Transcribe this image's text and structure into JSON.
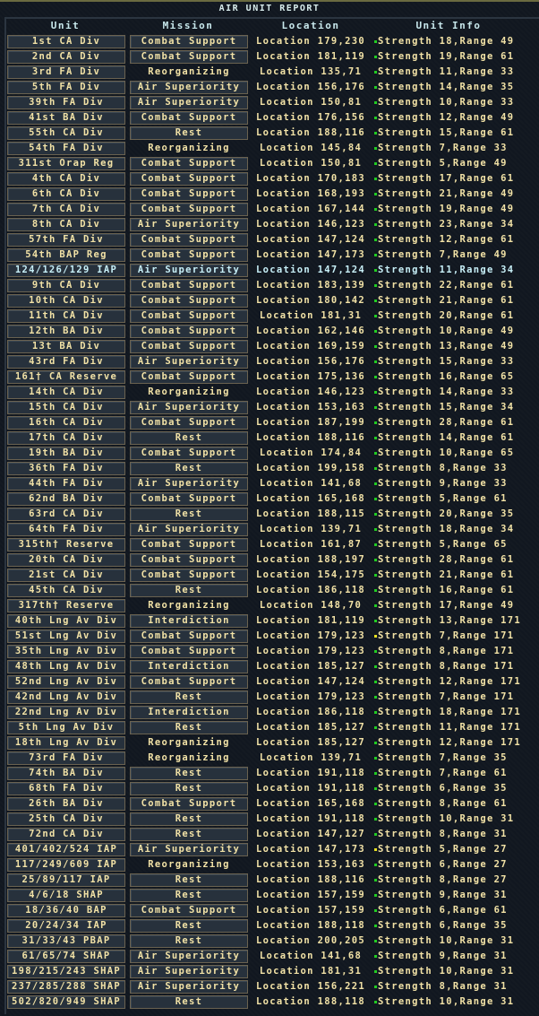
{
  "title": "AIR UNIT REPORT",
  "columns": {
    "unit": "Unit",
    "mission": "Mission",
    "location": "Location",
    "info": "Unit Info"
  },
  "colors": {
    "text": "#f2e2a6",
    "selected_text": "#c8f0f8",
    "dot_green": "#22cc22",
    "dot_yellow": "#e8e020"
  },
  "rows": [
    [
      "1st CA Div",
      "Combat Support",
      "Location 179,230",
      "Strength 18,Range 49"
    ],
    [
      "2nd CA Div",
      "Combat Support",
      "Location 181,119",
      "Strength 19,Range 61"
    ],
    [
      "3rd FA Div",
      "Reorganizing",
      "Location 135,71",
      "Strength 11,Range 33"
    ],
    [
      "5th FA Div",
      "Air Superiority",
      "Location 156,176",
      "Strength 14,Range 35"
    ],
    [
      "39th FA Div",
      "Air Superiority",
      "Location 150,81",
      "Strength 10,Range 33"
    ],
    [
      "41st BA Div",
      "Combat Support",
      "Location 176,156",
      "Strength 12,Range 49"
    ],
    [
      "55th CA Div",
      "Rest",
      "Location 188,116",
      "Strength 15,Range 61"
    ],
    [
      "54th FA Div",
      "Reorganizing",
      "Location 145,84",
      "Strength 7,Range 33"
    ],
    [
      "311st Orap Reg",
      "Combat Support",
      "Location 150,81",
      "Strength 5,Range 49"
    ],
    [
      "4th CA Div",
      "Combat Support",
      "Location 170,183",
      "Strength 17,Range 61"
    ],
    [
      "6th CA Div",
      "Combat Support",
      "Location 168,193",
      "Strength 21,Range 49"
    ],
    [
      "7th CA Div",
      "Combat Support",
      "Location 167,144",
      "Strength 19,Range 49"
    ],
    [
      "8th CA Div",
      "Air Superiority",
      "Location 146,123",
      "Strength 23,Range 34"
    ],
    [
      "57th FA Div",
      "Combat Support",
      "Location 147,124",
      "Strength 12,Range 61"
    ],
    [
      "54th BAP Reg",
      "Combat Support",
      "Location 147,173",
      "Strength 7,Range 49"
    ],
    [
      "124/126/129 IAP",
      "Air Superiority",
      "Location 147,124",
      "Strength 11,Range 34"
    ],
    [
      "9th CA Div",
      "Combat Support",
      "Location 183,139",
      "Strength 22,Range 61"
    ],
    [
      "10th CA Div",
      "Combat Support",
      "Location 180,142",
      "Strength 21,Range 61"
    ],
    [
      "11th CA Div",
      "Combat Support",
      "Location 181,31",
      "Strength 20,Range 61"
    ],
    [
      "12th BA Div",
      "Combat Support",
      "Location 162,146",
      "Strength 10,Range 49"
    ],
    [
      "13t BA Div",
      "Combat Support",
      "Location 169,159",
      "Strength 13,Range 49"
    ],
    [
      "43rd FA Div",
      "Air Superiority",
      "Location 156,176",
      "Strength 15,Range 33"
    ],
    [
      "161† CA Reserve",
      "Combat Support",
      "Location 175,136",
      "Strength 16,Range 65"
    ],
    [
      "14th CA Div",
      "Reorganizing",
      "Location 146,123",
      "Strength 14,Range 33"
    ],
    [
      "15th CA Div",
      "Air Superiority",
      "Location 153,163",
      "Strength 15,Range 34"
    ],
    [
      "16th CA Div",
      "Combat Support",
      "Location 187,199",
      "Strength 28,Range 61"
    ],
    [
      "17th CA Div",
      "Rest",
      "Location 188,116",
      "Strength 14,Range 61"
    ],
    [
      "19th BA Div",
      "Combat Support",
      "Location 174,84",
      "Strength 10,Range 65"
    ],
    [
      "36th FA Div",
      "Rest",
      "Location 199,158",
      "Strength 8,Range 33"
    ],
    [
      "44th FA Div",
      "Air Superiority",
      "Location 141,68",
      "Strength 9,Range 33"
    ],
    [
      "62nd BA Div",
      "Combat Support",
      "Location 165,168",
      "Strength 5,Range 61"
    ],
    [
      "63rd CA Div",
      "Rest",
      "Location 188,115",
      "Strength 20,Range 35"
    ],
    [
      "64th FA Div",
      "Air Superiority",
      "Location 139,71",
      "Strength 18,Range 34"
    ],
    [
      "315th† Reserve",
      "Combat Support",
      "Location 161,87",
      "Strength 5,Range 65"
    ],
    [
      "20th CA Div",
      "Combat Support",
      "Location 188,197",
      "Strength 28,Range 61"
    ],
    [
      "21st CA Div",
      "Combat Support",
      "Location 154,175",
      "Strength 21,Range 61"
    ],
    [
      "45th CA Div",
      "Rest",
      "Location 186,118",
      "Strength 16,Range 61"
    ],
    [
      "317th† Reserve",
      "Reorganizing",
      "Location 148,70",
      "Strength 17,Range 49"
    ],
    [
      "40th Lng Av Div",
      "Interdiction",
      "Location 181,119",
      "Strength 13,Range 171"
    ],
    [
      "51st Lng Av Div",
      "Combat Support",
      "Location 179,123",
      "Strength 7,Range 171"
    ],
    [
      "35th Lng Av Div",
      "Combat Support",
      "Location 179,123",
      "Strength 8,Range 171"
    ],
    [
      "48th Lng Av Div",
      "Interdiction",
      "Location 185,127",
      "Strength 8,Range 171"
    ],
    [
      "52nd Lng Av Div",
      "Combat Support",
      "Location 147,124",
      "Strength 12,Range 171"
    ],
    [
      "42nd Lng Av Div",
      "Rest",
      "Location 179,123",
      "Strength 7,Range 171"
    ],
    [
      "22nd Lng Av Div",
      "Interdiction",
      "Location 186,118",
      "Strength 18,Range 171"
    ],
    [
      "5th Lng Av Div",
      "Rest",
      "Location 185,127",
      "Strength 11,Range 171"
    ],
    [
      "18th Lng Av Div",
      "Reorganizing",
      "Location 185,127",
      "Strength 12,Range 171"
    ],
    [
      "73rd FA Div",
      "Reorganizing",
      "Location 139,71",
      "Strength 7,Range 35"
    ],
    [
      "74th BA Div",
      "Rest",
      "Location 191,118",
      "Strength 7,Range 61"
    ],
    [
      "68th FA Div",
      "Rest",
      "Location 191,118",
      "Strength 6,Range 35"
    ],
    [
      "26th BA Div",
      "Combat Support",
      "Location 165,168",
      "Strength 8,Range 61"
    ],
    [
      "25th CA Div",
      "Rest",
      "Location 191,118",
      "Strength 10,Range 31"
    ],
    [
      "72nd CA Div",
      "Rest",
      "Location 147,127",
      "Strength 8,Range 31"
    ],
    [
      "401/402/524 IAP",
      "Air Superiority",
      "Location 147,173",
      "Strength 5,Range 27"
    ],
    [
      "117/249/609 IAP",
      "Reorganizing",
      "Location 153,163",
      "Strength 6,Range 27"
    ],
    [
      "25/89/117 IAP",
      "Rest",
      "Location 188,116",
      "Strength 8,Range 27"
    ],
    [
      "4/6/18 SHAP",
      "Rest",
      "Location 157,159",
      "Strength 9,Range 31"
    ],
    [
      "18/36/40 BAP",
      "Combat Support",
      "Location 157,159",
      "Strength 6,Range 61"
    ],
    [
      "20/24/34 IAP",
      "Rest",
      "Location 188,118",
      "Strength 6,Range 35"
    ],
    [
      "31/33/43 PBAP",
      "Rest",
      "Location 200,205",
      "Strength 10,Range 31"
    ],
    [
      "61/65/74 SHAP",
      "Air Superiority",
      "Location 141,68",
      "Strength 9,Range 31"
    ],
    [
      "198/215/243 SHAP",
      "Air Superiority",
      "Location 181,31",
      "Strength 10,Range 31"
    ],
    [
      "237/285/288 SHAP",
      "Air Superiority",
      "Location 156,221",
      "Strength 8,Range 31"
    ],
    [
      "502/820/949 SHAP",
      "Rest",
      "Location 188,118",
      "Strength 10,Range 31"
    ]
  ],
  "selected_row": 15,
  "yellow_dot_rows": [
    39,
    53
  ]
}
